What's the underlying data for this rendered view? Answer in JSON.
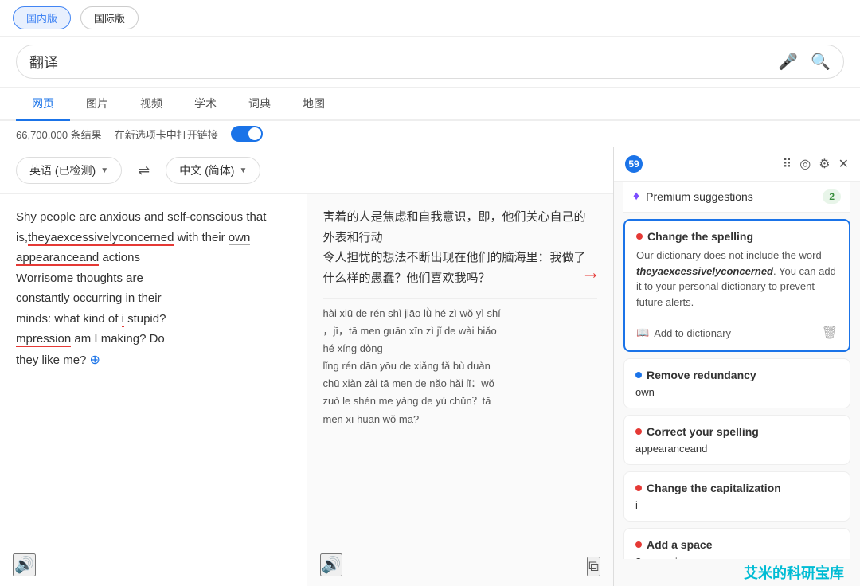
{
  "tabs": {
    "domestic": "国内版",
    "international": "国际版"
  },
  "search": {
    "query": "翻译",
    "mic_icon": "🎤",
    "search_icon": "🔍"
  },
  "nav": {
    "items": [
      "网页",
      "图片",
      "视频",
      "学术",
      "词典",
      "地图"
    ],
    "active": "网页"
  },
  "results": {
    "count": "66,700,000 条结果",
    "new_tab_label": "在新选项卡中打开链接"
  },
  "translation": {
    "source_lang": "英语 (已检测)",
    "target_lang": "中文 (简体)",
    "source_text_parts": [
      "Shy people are anxious and self-conscious that is,",
      "theyaexcessivelyconcerned",
      " with their ",
      "own",
      "\nappearanceand",
      " actions\nWorrisome thoughts are\nconstantly occurring in their\nminds: what kind of ",
      "i",
      " stupid?\n",
      "mpression",
      " am I making? Do\nthey like me?"
    ],
    "target_text": "害着的人是焦虑和自我意识，即，他们关心自己的外表和行动\n令人担忧的想法不断出现在他们的脑海里：我做了什么样的愚蠢？他们喜欢我吗？",
    "transliteration": "hài xiū de rén shì jiāo lǜ hé zì wǒ yì shí，jī，tā men guān xīn zì jǐ de wài biǎo hé xíng dòng\nlǐng rén dān yōu de xiǎng fǎ bù duàn chū xiàn zài tā men de nǎo hǎi lǐ：wǒ zuò le shén me yàng de yú chǔn？tā men xī huān wǒ ma?"
  },
  "grammar": {
    "count": "59",
    "premium_label": "Premium suggestions",
    "premium_count": "2",
    "suggestions": [
      {
        "type": "active",
        "dot": "red",
        "title": "Change the spelling",
        "body": "Our dictionary does not include the word",
        "word": "theyaexcessivelyconcerned",
        "body2": ". You can add it to your personal dictionary to prevent future alerts.",
        "action": "Add to dictionary",
        "has_trash": true
      },
      {
        "type": "normal",
        "dot": "blue",
        "title": "Remove redundancy",
        "value": "own"
      },
      {
        "type": "normal",
        "dot": "red",
        "title": "Correct your spelling",
        "value": "appearanceand"
      },
      {
        "type": "normal",
        "dot": "red",
        "title": "Change the capitalization",
        "value": "i"
      },
      {
        "type": "normal",
        "dot": "red",
        "title": "Add a space",
        "value": "?mpression"
      }
    ]
  },
  "branding": "艾米的科研宝库"
}
